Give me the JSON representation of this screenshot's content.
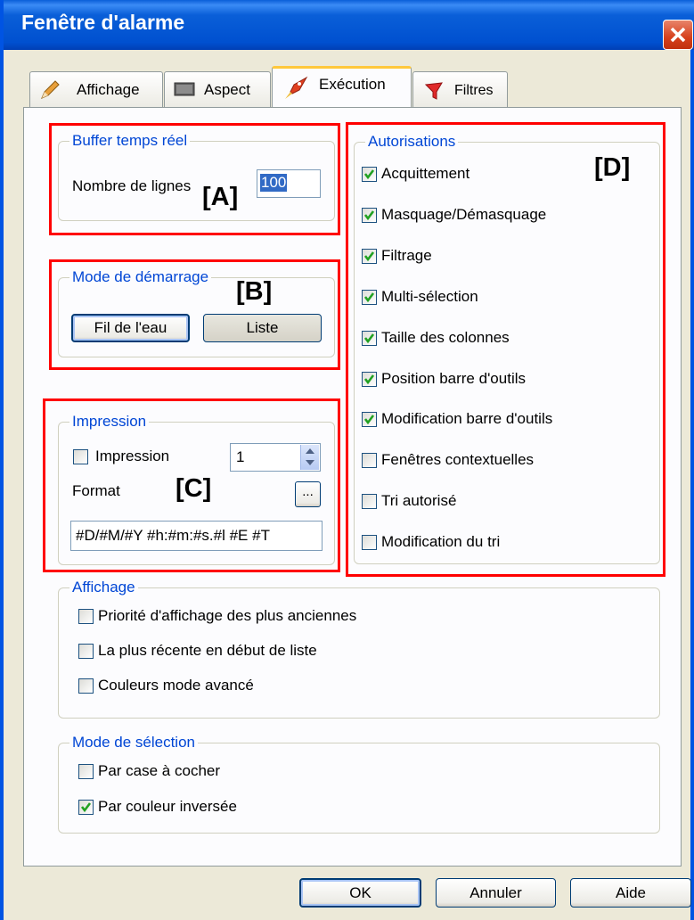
{
  "window": {
    "title": "Fenêtre d'alarme",
    "close_icon": "close-icon"
  },
  "tabs": [
    {
      "label": "Affichage",
      "icon": "pencil-icon"
    },
    {
      "label": "Aspect",
      "icon": "monitor-icon"
    },
    {
      "label": "Exécution",
      "icon": "rocket-icon",
      "active": true
    },
    {
      "label": "Filtres",
      "icon": "funnel-icon"
    }
  ],
  "buffer": {
    "legend": "Buffer temps réel",
    "lines_label": "Nombre de lignes",
    "lines_value": "100"
  },
  "startup": {
    "legend": "Mode de démarrage",
    "button1": "Fil de l'eau",
    "button2": "Liste"
  },
  "printing": {
    "legend": "Impression",
    "checkbox_label": "Impression",
    "checkbox_checked": false,
    "count_value": "1",
    "format_label": "Format",
    "browse_label": "...",
    "format_value": "#D/#M/#Y #h:#m:#s.#l #E #T"
  },
  "authorizations": {
    "legend": "Autorisations",
    "items": [
      {
        "label": "Acquittement",
        "checked": true
      },
      {
        "label": "Masquage/Démasquage",
        "checked": true
      },
      {
        "label": "Filtrage",
        "checked": true
      },
      {
        "label": "Multi-sélection",
        "checked": true
      },
      {
        "label": "Taille des colonnes",
        "checked": true
      },
      {
        "label": "Position barre d'outils",
        "checked": true
      },
      {
        "label": "Modification barre d'outils",
        "checked": true
      },
      {
        "label": "Fenêtres contextuelles",
        "checked": false
      },
      {
        "label": "Tri autorisé",
        "checked": false
      },
      {
        "label": "Modification du tri",
        "checked": false
      }
    ]
  },
  "display": {
    "legend": "Affichage",
    "items": [
      {
        "label": "Priorité d'affichage des plus anciennes",
        "checked": false
      },
      {
        "label": "La plus récente en début de liste",
        "checked": false
      },
      {
        "label": "Couleurs mode avancé",
        "checked": false
      }
    ]
  },
  "selection": {
    "legend": "Mode de sélection",
    "items": [
      {
        "label": "Par case à cocher",
        "checked": false
      },
      {
        "label": "Par couleur inversée",
        "checked": true
      }
    ]
  },
  "footer": {
    "ok": "OK",
    "cancel": "Annuler",
    "help": "Aide"
  },
  "annotations": {
    "a": "[A]",
    "b": "[B]",
    "c": "[C]",
    "d": "[D]"
  },
  "colors": {
    "annotation": "#ff0000",
    "legend_text": "#0046d5",
    "check_mark": "#21a121",
    "title_bar": "#0054e3"
  }
}
